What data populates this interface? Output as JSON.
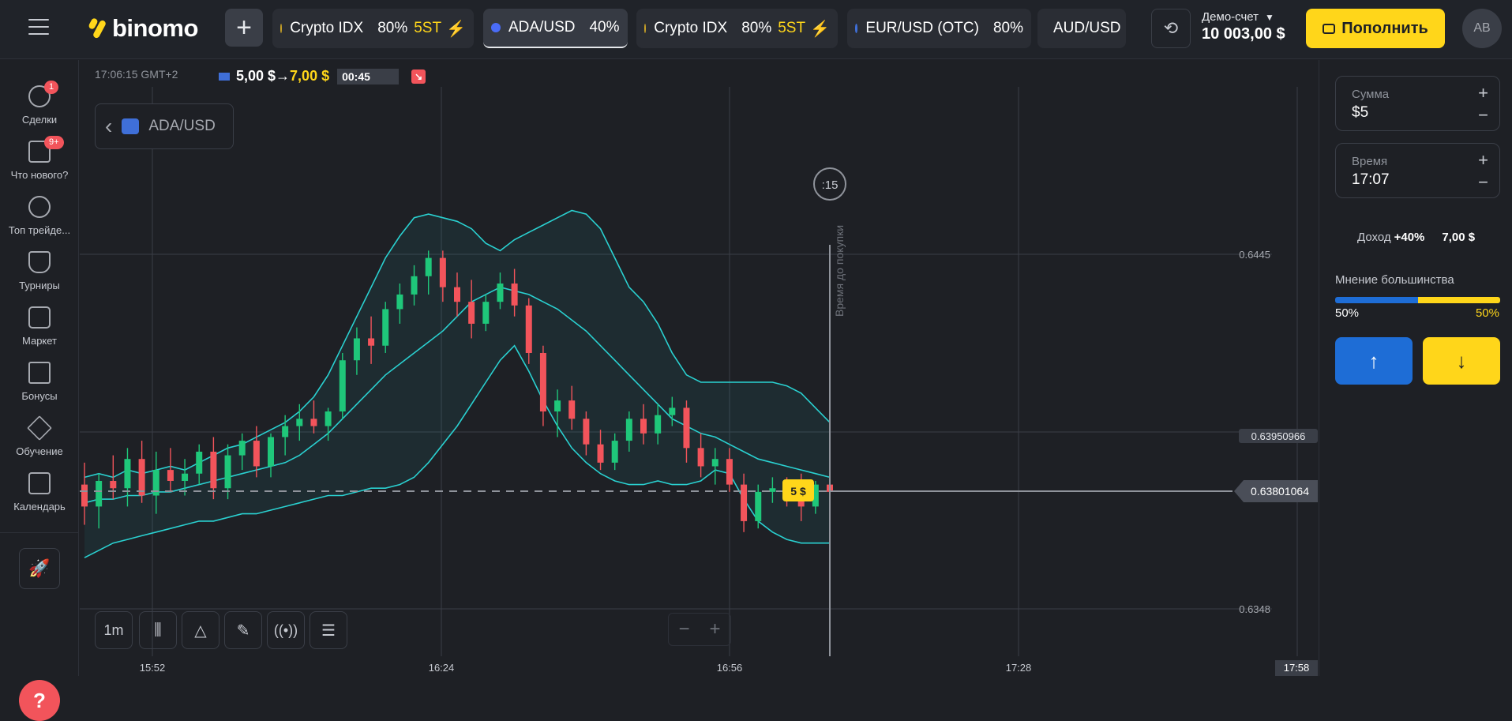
{
  "header": {
    "logo": "binomo",
    "add_tab_symbol": "+",
    "tabs": [
      {
        "name": "Crypto IDX",
        "pct": "80%",
        "st": "5ST",
        "bolt": "⚡",
        "active": false
      },
      {
        "name": "ADA/USD",
        "pct": "40%",
        "st": "",
        "bolt": "",
        "active": true
      },
      {
        "name": "Crypto IDX",
        "pct": "80%",
        "st": "5ST",
        "bolt": "⚡",
        "active": false
      },
      {
        "name": "EUR/USD (OTC)",
        "pct": "80%",
        "st": "",
        "bolt": "",
        "active": false
      },
      {
        "name": "AUD/USD",
        "pct": "",
        "st": "",
        "bolt": "",
        "active": false
      }
    ],
    "account_label": "Демо-счет",
    "account_caret": "▼",
    "balance": "10 003,00 $",
    "deposit_label": "Пополнить",
    "avatar_initials": "AB",
    "switch_icon": "⟲"
  },
  "sidebar": {
    "items": [
      {
        "label": "Сделки",
        "icon": "clock-icon",
        "badge": "1"
      },
      {
        "label": "Что нового?",
        "icon": "megaphone-icon",
        "badge": "9+"
      },
      {
        "label": "Топ трейде...",
        "icon": "medal-icon",
        "badge": ""
      },
      {
        "label": "Турниры",
        "icon": "trophy-icon",
        "badge": ""
      },
      {
        "label": "Маркет",
        "icon": "bag-icon",
        "badge": ""
      },
      {
        "label": "Бонусы",
        "icon": "gift-icon",
        "badge": ""
      },
      {
        "label": "Обучение",
        "icon": "graduation-cap-icon",
        "badge": ""
      },
      {
        "label": "Календарь",
        "icon": "calendar-icon",
        "badge": ""
      }
    ],
    "rocket_icon": "🚀",
    "help_symbol": "?"
  },
  "chart_area": {
    "time_label": "17:06:15 GMT+2",
    "trade_from": "5,00 $",
    "trade_arrow": "→",
    "trade_to": "7,00 $",
    "countdown": "00:45",
    "asset_back": "‹",
    "asset_name": "ADA/USD",
    "timer_circle": ":15",
    "buy_time_label": "Время до покупки",
    "bet_marker": "5 $",
    "timeframe": "1m",
    "zoom_minus": "−",
    "zoom_plus": "+",
    "price_labels": [
      "0.6445",
      "0.63950966",
      "0.63801064",
      "0.6348"
    ],
    "time_labels": [
      "15:52",
      "16:24",
      "16:56",
      "17:28",
      "17:58"
    ],
    "colors": {
      "up": "#1fc77a",
      "down": "#f2545b",
      "band": "#2ad1d1",
      "marker": "#ffd61a"
    }
  },
  "panel": {
    "amount_label": "Сумма",
    "amount_value": "$5",
    "time_label": "Время",
    "time_value": "17:07",
    "plus": "+",
    "minus": "−",
    "income_label": "Доход",
    "income_pct": "+40%",
    "income_amount": "7,00 $",
    "opinion_title": "Мнение большинства",
    "opinion_up": "50%",
    "opinion_down": "50%",
    "up_arrow": "↑",
    "down_arrow": "↓"
  },
  "chart_data": {
    "type": "candlestick",
    "series": [
      {
        "x": 0,
        "open": 0.6382,
        "high": 0.6388,
        "low": 0.6371,
        "close": 0.6376
      },
      {
        "x": 1,
        "open": 0.6376,
        "high": 0.6385,
        "low": 0.637,
        "close": 0.6383
      },
      {
        "x": 2,
        "open": 0.6383,
        "high": 0.639,
        "low": 0.6378,
        "close": 0.6381
      },
      {
        "x": 3,
        "open": 0.6381,
        "high": 0.6392,
        "low": 0.6376,
        "close": 0.6389
      },
      {
        "x": 4,
        "open": 0.6389,
        "high": 0.6394,
        "low": 0.6377,
        "close": 0.6379
      },
      {
        "x": 5,
        "open": 0.6379,
        "high": 0.6391,
        "low": 0.6374,
        "close": 0.6386
      },
      {
        "x": 6,
        "open": 0.6386,
        "high": 0.6392,
        "low": 0.638,
        "close": 0.6383
      },
      {
        "x": 7,
        "open": 0.6383,
        "high": 0.6389,
        "low": 0.6379,
        "close": 0.6385
      },
      {
        "x": 8,
        "open": 0.6385,
        "high": 0.6393,
        "low": 0.6382,
        "close": 0.6391
      },
      {
        "x": 9,
        "open": 0.6391,
        "high": 0.6395,
        "low": 0.6378,
        "close": 0.6381
      },
      {
        "x": 10,
        "open": 0.6381,
        "high": 0.6393,
        "low": 0.6378,
        "close": 0.639
      },
      {
        "x": 11,
        "open": 0.639,
        "high": 0.6396,
        "low": 0.6386,
        "close": 0.6394
      },
      {
        "x": 12,
        "open": 0.6394,
        "high": 0.6398,
        "low": 0.6384,
        "close": 0.6387
      },
      {
        "x": 13,
        "open": 0.6387,
        "high": 0.6396,
        "low": 0.6384,
        "close": 0.6395
      },
      {
        "x": 14,
        "open": 0.6395,
        "high": 0.6401,
        "low": 0.639,
        "close": 0.6398
      },
      {
        "x": 15,
        "open": 0.6398,
        "high": 0.6404,
        "low": 0.6394,
        "close": 0.64
      },
      {
        "x": 16,
        "open": 0.64,
        "high": 0.6405,
        "low": 0.6396,
        "close": 0.6398
      },
      {
        "x": 17,
        "open": 0.6398,
        "high": 0.6403,
        "low": 0.6394,
        "close": 0.6402
      },
      {
        "x": 18,
        "open": 0.6402,
        "high": 0.6418,
        "low": 0.64,
        "close": 0.6416
      },
      {
        "x": 19,
        "open": 0.6416,
        "high": 0.6425,
        "low": 0.6412,
        "close": 0.6422
      },
      {
        "x": 20,
        "open": 0.6422,
        "high": 0.6428,
        "low": 0.6415,
        "close": 0.642
      },
      {
        "x": 21,
        "open": 0.642,
        "high": 0.6432,
        "low": 0.6418,
        "close": 0.643
      },
      {
        "x": 22,
        "open": 0.643,
        "high": 0.6437,
        "low": 0.6426,
        "close": 0.6434
      },
      {
        "x": 23,
        "open": 0.6434,
        "high": 0.6442,
        "low": 0.6431,
        "close": 0.6439
      },
      {
        "x": 24,
        "open": 0.6439,
        "high": 0.6446,
        "low": 0.6434,
        "close": 0.6444
      },
      {
        "x": 25,
        "open": 0.6444,
        "high": 0.6446,
        "low": 0.6432,
        "close": 0.6436
      },
      {
        "x": 26,
        "open": 0.6436,
        "high": 0.644,
        "low": 0.6428,
        "close": 0.6432
      },
      {
        "x": 27,
        "open": 0.6432,
        "high": 0.6438,
        "low": 0.6422,
        "close": 0.6426
      },
      {
        "x": 28,
        "open": 0.6426,
        "high": 0.6434,
        "low": 0.6424,
        "close": 0.6432
      },
      {
        "x": 29,
        "open": 0.6432,
        "high": 0.644,
        "low": 0.643,
        "close": 0.6437
      },
      {
        "x": 30,
        "open": 0.6437,
        "high": 0.6441,
        "low": 0.6428,
        "close": 0.6431
      },
      {
        "x": 31,
        "open": 0.6431,
        "high": 0.6433,
        "low": 0.6415,
        "close": 0.6418
      },
      {
        "x": 32,
        "open": 0.6418,
        "high": 0.642,
        "low": 0.6398,
        "close": 0.6402
      },
      {
        "x": 33,
        "open": 0.6402,
        "high": 0.6408,
        "low": 0.6395,
        "close": 0.6405
      },
      {
        "x": 34,
        "open": 0.6405,
        "high": 0.6409,
        "low": 0.6397,
        "close": 0.64
      },
      {
        "x": 35,
        "open": 0.64,
        "high": 0.6402,
        "low": 0.639,
        "close": 0.6393
      },
      {
        "x": 36,
        "open": 0.6393,
        "high": 0.6397,
        "low": 0.6386,
        "close": 0.6388
      },
      {
        "x": 37,
        "open": 0.6388,
        "high": 0.6396,
        "low": 0.6386,
        "close": 0.6394
      },
      {
        "x": 38,
        "open": 0.6394,
        "high": 0.6402,
        "low": 0.6391,
        "close": 0.64
      },
      {
        "x": 39,
        "open": 0.64,
        "high": 0.6404,
        "low": 0.6393,
        "close": 0.6396
      },
      {
        "x": 40,
        "open": 0.6396,
        "high": 0.6404,
        "low": 0.6393,
        "close": 0.6401
      },
      {
        "x": 41,
        "open": 0.6401,
        "high": 0.6406,
        "low": 0.6398,
        "close": 0.6403
      },
      {
        "x": 42,
        "open": 0.6403,
        "high": 0.6405,
        "low": 0.6388,
        "close": 0.6392
      },
      {
        "x": 43,
        "open": 0.6392,
        "high": 0.6396,
        "low": 0.6384,
        "close": 0.6387
      },
      {
        "x": 44,
        "open": 0.6387,
        "high": 0.6392,
        "low": 0.6382,
        "close": 0.6389
      },
      {
        "x": 45,
        "open": 0.6389,
        "high": 0.6392,
        "low": 0.638,
        "close": 0.6382
      },
      {
        "x": 46,
        "open": 0.6382,
        "high": 0.6385,
        "low": 0.6369,
        "close": 0.6372
      },
      {
        "x": 47,
        "open": 0.6372,
        "high": 0.6382,
        "low": 0.637,
        "close": 0.638
      },
      {
        "x": 48,
        "open": 0.638,
        "high": 0.6384,
        "low": 0.6377,
        "close": 0.6381
      },
      {
        "x": 49,
        "open": 0.6381,
        "high": 0.6384,
        "low": 0.6376,
        "close": 0.6379
      },
      {
        "x": 50,
        "open": 0.6379,
        "high": 0.6385,
        "low": 0.6372,
        "close": 0.6376
      },
      {
        "x": 51,
        "open": 0.6376,
        "high": 0.6383,
        "low": 0.6374,
        "close": 0.6382
      },
      {
        "x": 52,
        "open": 0.6382,
        "high": 0.6385,
        "low": 0.6378,
        "close": 0.638
      }
    ],
    "bands": {
      "upper": [
        0.6384,
        0.6385,
        0.6384,
        0.6386,
        0.6385,
        0.6386,
        0.6387,
        0.6386,
        0.6388,
        0.639,
        0.6392,
        0.6393,
        0.6395,
        0.6397,
        0.6399,
        0.6402,
        0.6406,
        0.6412,
        0.642,
        0.6428,
        0.6436,
        0.6444,
        0.645,
        0.6455,
        0.6456,
        0.6455,
        0.6454,
        0.6452,
        0.6448,
        0.6446,
        0.6449,
        0.6451,
        0.6453,
        0.6455,
        0.6457,
        0.6456,
        0.6452,
        0.6444,
        0.6436,
        0.6432,
        0.6426,
        0.6418,
        0.6412,
        0.641,
        0.641,
        0.641,
        0.641,
        0.641,
        0.641,
        0.6409,
        0.6407,
        0.6403,
        0.6399
      ],
      "middle": [
        0.6377,
        0.6378,
        0.6378,
        0.6379,
        0.6379,
        0.638,
        0.638,
        0.6381,
        0.6382,
        0.6383,
        0.6384,
        0.6385,
        0.6386,
        0.6387,
        0.6388,
        0.639,
        0.6393,
        0.6396,
        0.64,
        0.6404,
        0.6408,
        0.6412,
        0.6415,
        0.6418,
        0.6421,
        0.6424,
        0.6428,
        0.6432,
        0.6434,
        0.6436,
        0.6435,
        0.6434,
        0.6432,
        0.643,
        0.6427,
        0.6424,
        0.642,
        0.6416,
        0.6412,
        0.6408,
        0.6404,
        0.64,
        0.6398,
        0.6396,
        0.6395,
        0.6393,
        0.6391,
        0.6389,
        0.6388,
        0.6387,
        0.6386,
        0.6385,
        0.6384
      ],
      "lower": [
        0.6362,
        0.6364,
        0.6366,
        0.6367,
        0.6368,
        0.6369,
        0.637,
        0.6371,
        0.6372,
        0.6372,
        0.6373,
        0.6374,
        0.6374,
        0.6375,
        0.6376,
        0.6377,
        0.6378,
        0.6379,
        0.6379,
        0.638,
        0.6381,
        0.6381,
        0.6382,
        0.6384,
        0.6388,
        0.6393,
        0.6398,
        0.6404,
        0.641,
        0.6416,
        0.642,
        0.6413,
        0.6405,
        0.6398,
        0.6392,
        0.6388,
        0.6385,
        0.6383,
        0.6382,
        0.6382,
        0.6383,
        0.6382,
        0.6382,
        0.6383,
        0.6386,
        0.6385,
        0.6378,
        0.6372,
        0.6369,
        0.6367,
        0.6366,
        0.6366,
        0.6366
      ]
    },
    "ylim": [
      0.634,
      0.6465
    ],
    "current_price": 0.63801064,
    "level_price": 0.63950966
  }
}
